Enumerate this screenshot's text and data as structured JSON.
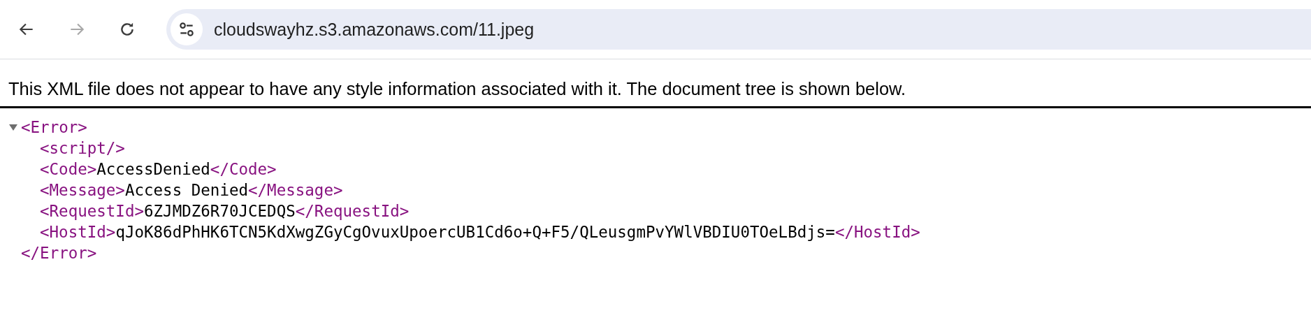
{
  "toolbar": {
    "buttons": [
      {
        "kind": "back",
        "disabled": false
      },
      {
        "kind": "forward",
        "disabled": true
      },
      {
        "kind": "reload",
        "disabled": false
      }
    ],
    "address": "cloudswayhz.s3.amazonaws.com/11.jpeg"
  },
  "notice": "This XML file does not appear to have any style information associated with it. The document tree is shown below.",
  "tree": {
    "open": "<Error>",
    "close": "</Error>",
    "expanded": true,
    "children": [
      {
        "open": "<script/>"
      },
      {
        "open": "<Code>",
        "text": "AccessDenied",
        "close": "</Code>"
      },
      {
        "open": "<Message>",
        "text": "Access Denied",
        "close": "</Message>"
      },
      {
        "open": "<RequestId>",
        "text": "6ZJMDZ6R70JCEDQS",
        "close": "</RequestId>"
      },
      {
        "open": "<HostId>",
        "text": "qJoK86dPhHK6TCN5KdXwgZGyCgOvuxUpoercUB1Cd6o+Q+F5/QLeusgmPvYWlVBDIU0TOeLBdjs=",
        "close": "</HostId>"
      }
    ]
  }
}
